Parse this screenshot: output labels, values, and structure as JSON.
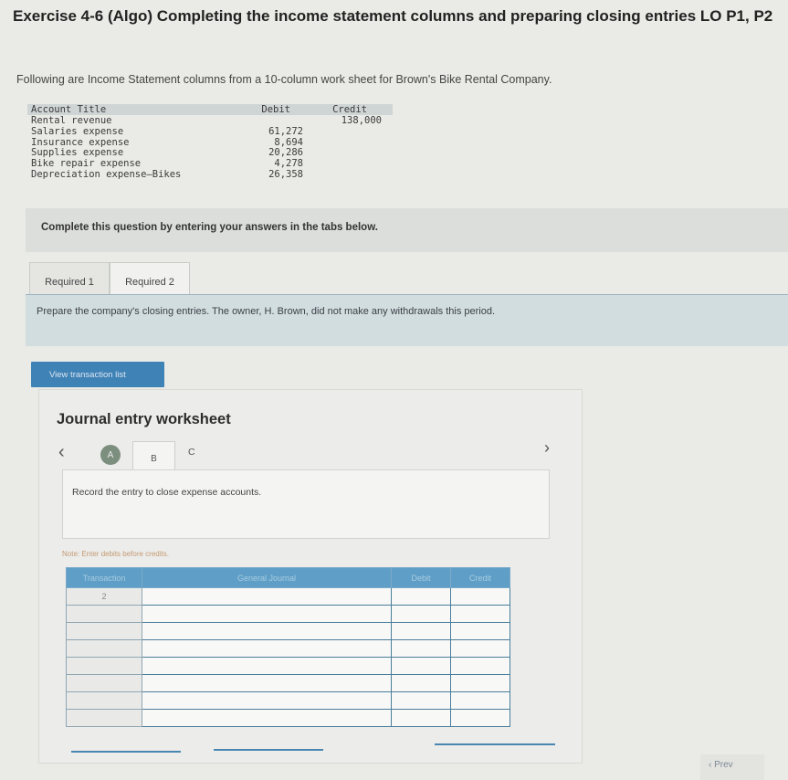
{
  "title": "Exercise 4-6 (Algo) Completing the income statement columns and preparing closing entries LO P1, P2",
  "intro": "Following are Income Statement columns from a 10-column work sheet for Brown's Bike Rental Company.",
  "work_sheet": {
    "headers": {
      "account": "Account Title",
      "debit": "Debit",
      "credit": "Credit"
    },
    "rows": [
      {
        "account": "Rental revenue",
        "debit": "",
        "credit": "138,000"
      },
      {
        "account": "Salaries expense",
        "debit": "61,272",
        "credit": ""
      },
      {
        "account": "Insurance expense",
        "debit": "8,694",
        "credit": ""
      },
      {
        "account": "Supplies expense",
        "debit": "20,286",
        "credit": ""
      },
      {
        "account": "Bike repair expense",
        "debit": "4,278",
        "credit": ""
      },
      {
        "account": "Depreciation expense—Bikes",
        "debit": "26,358",
        "credit": ""
      }
    ]
  },
  "instructions": "Complete this question by entering your answers in the tabs below.",
  "tabs": [
    {
      "label": "Required 1"
    },
    {
      "label": "Required 2"
    }
  ],
  "prompt": "Prepare the company's closing entries. The owner, H. Brown, did not make any withdrawals this period.",
  "view_button": "View transaction list",
  "journal_worksheet": {
    "title": "Journal entry worksheet",
    "steps": {
      "a": "A",
      "b": "B",
      "c": "C"
    },
    "entry_instruction": "Record the entry to close expense accounts.",
    "note": "Note: Enter debits before credits.",
    "columns": {
      "transaction": "Transaction",
      "general_journal": "General Journal",
      "debit": "Debit",
      "credit": "Credit"
    },
    "rows": [
      {
        "transaction": "2"
      },
      {
        "transaction": ""
      },
      {
        "transaction": ""
      },
      {
        "transaction": ""
      },
      {
        "transaction": ""
      },
      {
        "transaction": ""
      },
      {
        "transaction": ""
      },
      {
        "transaction": ""
      }
    ]
  },
  "footer": {
    "prev_label": "Prev"
  },
  "colors": {
    "accent": "#3f82b6",
    "table_header": "#5f9fc7",
    "step_done": "#7c8f7f"
  },
  "icons": {
    "prev": "chevron-left-icon",
    "next": "chevron-right-icon"
  }
}
